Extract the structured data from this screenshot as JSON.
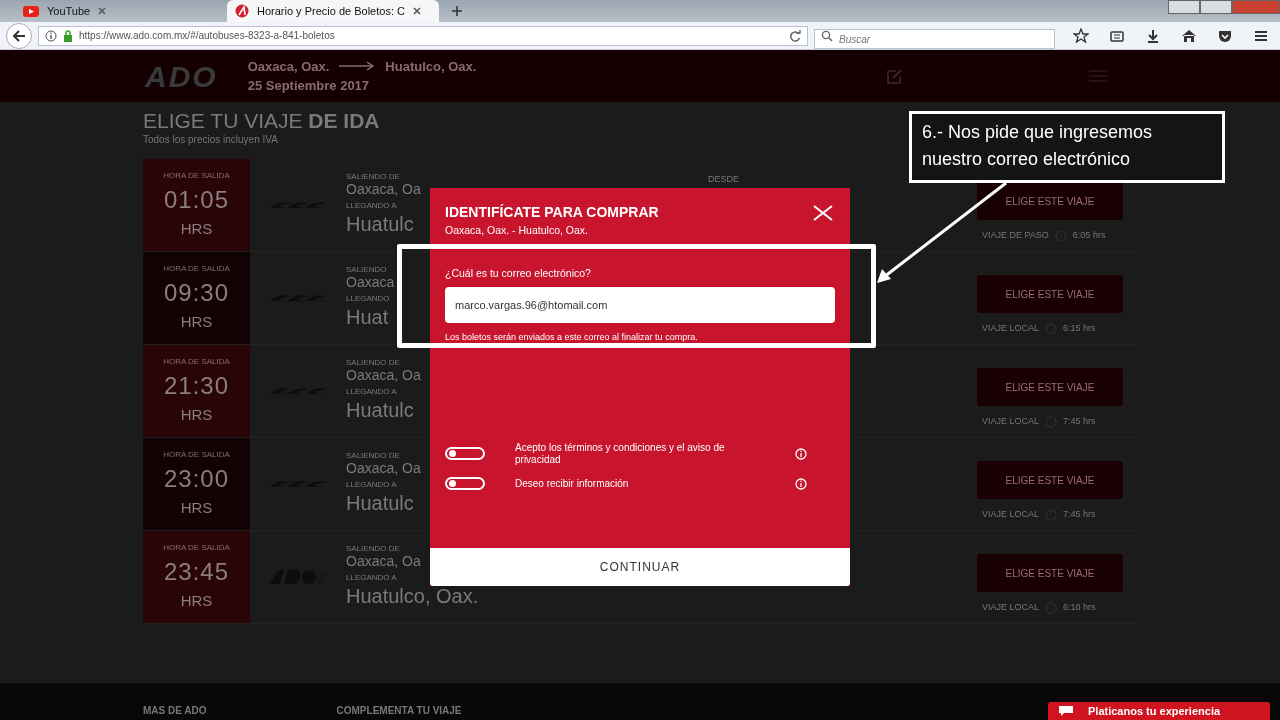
{
  "browser": {
    "tabs": [
      {
        "title": "YouTube",
        "selected": false,
        "kind": "youtube"
      },
      {
        "title": "Horario y Precio de Boletos: C",
        "selected": true,
        "kind": "ado"
      }
    ],
    "url": "https://www.ado.com.mx/#/autobuses-8323-a-841-boletos",
    "search": {
      "placeholder": "Buscar"
    }
  },
  "header": {
    "logo": "ADO",
    "origin": "Oaxaca, Oax.",
    "destination": "Huatulco, Oax.",
    "date": "25 Septiembre 2017"
  },
  "page": {
    "title": "ELIGE TU VIAJE **DE IDA**",
    "subtitle": "Todos los precios incluyen IVA",
    "price_label": "DESDE"
  },
  "trips": [
    {
      "departure_label": "HORA DE SALIDA",
      "time": "01:05",
      "unit": "HRS",
      "carrier_logo": {
        "kind": "occ"
      },
      "from_label": "SALIENDO DE",
      "from": "Oaxaca, Oa",
      "to_label": "LLEGANDO A",
      "to": "Huatulc",
      "button": "ELIGE ESTE VIAJE",
      "trip_type": "VIAJE DE PASO",
      "duration": "6:05 hrs",
      "dark": false
    },
    {
      "departure_label": "HORA DE SALIDA",
      "time": "09:30",
      "unit": "HRS",
      "carrier_logo": {
        "kind": "occ"
      },
      "from_label": "SALIENDO",
      "from": "Oaxaca",
      "to_label": "LLEGANDO",
      "to": "Huat",
      "button": "ELIGE ESTE VIAJE",
      "trip_type": "VIAJE LOCAL",
      "duration": "6:15 hrs",
      "dark": true
    },
    {
      "departure_label": "HORA DE SALIDA",
      "time": "21:30",
      "unit": "HRS",
      "carrier_logo": {
        "kind": "occ"
      },
      "from_label": "SALIENDO DE",
      "from": "Oaxaca, Oa",
      "to_label": "LLEGANDO A",
      "to": "Huatulc",
      "button": "ELIGE ESTE VIAJE",
      "trip_type": "VIAJE LOCAL",
      "duration": "7:45 hrs",
      "dark": false
    },
    {
      "departure_label": "HORA DE SALIDA",
      "time": "23:00",
      "unit": "HRS",
      "carrier_logo": {
        "kind": "occ"
      },
      "from_label": "SALIENDO DE",
      "from": "Oaxaca, Oa",
      "to_label": "LLEGANDO A",
      "to": "Huatulc",
      "button": "ELIGE ESTE VIAJE",
      "trip_type": "VIAJE LOCAL",
      "duration": "7:45 hrs",
      "dark": true
    },
    {
      "departure_label": "HORA DE SALIDA",
      "time": "23:45",
      "unit": "HRS",
      "carrier_logo": {
        "kind": "ado"
      },
      "from_label": "SALIENDO DE",
      "from": "Oaxaca, Oa",
      "to_label": "LLEGANDO A",
      "to": "Huatulco, Oax.",
      "button": "ELIGE ESTE VIAJE",
      "trip_type": "VIAJE LOCAL",
      "duration": "6:10 hrs",
      "dark": false
    }
  ],
  "modal": {
    "title": "IDENTIFÍCATE PARA COMPRAR",
    "route": "Oaxaca, Oax. - Huatulco, Oax.",
    "email_label": "¿Cuál es tu correo electrónico?",
    "email": "marco.vargas.96@htomail.com",
    "hint": "Los boletos serán enviados a este correo al finalizar tu compra.",
    "toggles": [
      {
        "label": "Acepto los términos y condiciones y el aviso de privacidad",
        "on": false
      },
      {
        "label": "Deseo recibir información",
        "on": false
      }
    ],
    "button": "CONTINUAR"
  },
  "callout": "6.- Nos pide que ingresemos nuestro correo electrónico",
  "footer": {
    "columns": [
      "MAS DE ADO",
      "COMPLEMENTA TU VIAJE"
    ],
    "feedback": "Platicanos tu experiencia"
  }
}
